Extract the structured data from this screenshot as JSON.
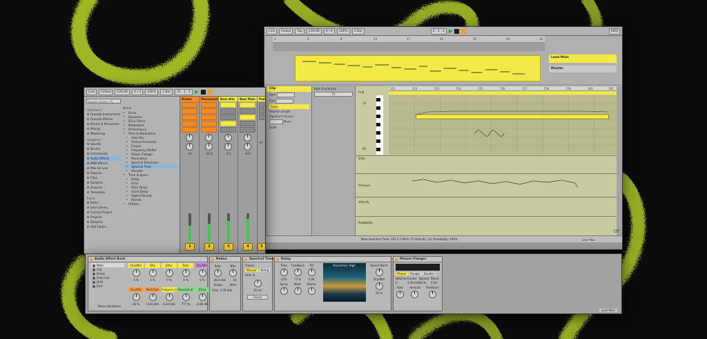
{
  "back_window": {
    "toolbar": {
      "link": "Link",
      "follow": "Follow",
      "tap": "Tap",
      "tempo": "120.00",
      "sig": "4 / 4",
      "cpu": "100%",
      "quant": "1 Bar",
      "midi": "MIDI",
      "arrangement_time": "2 . 1 . 1"
    },
    "arrangement": {
      "ruler_marks": [
        "1",
        "5",
        "9",
        "13",
        "17",
        "21",
        "25",
        "29",
        "33"
      ],
      "time_marks": [
        "0:00",
        "0:04",
        "0:08",
        "0:12",
        "0:16",
        "0:20",
        "0:24",
        "0:28",
        "0:32"
      ],
      "track_name": "Lead Main",
      "master_name": "Master",
      "track_number": "12"
    },
    "clip_panel": {
      "title": "Clip",
      "start_label": "Start",
      "end_label": "End",
      "loop_label": "Loop",
      "position_label": "Position",
      "length_label": "Length",
      "signature_label": "Signature",
      "groove_label": "Groove",
      "groove_value": "None",
      "scale_label": "Scale",
      "start_value": "1",
      "end_value": "3",
      "sig_value": "4 / 4"
    },
    "envelope_panel": {
      "title": "Note Expression",
      "value": "F3"
    },
    "midi_editor": {
      "ruler": [
        "151",
        "152",
        "153",
        "154",
        "155",
        "156",
        "157",
        "158",
        "159",
        "160",
        "161"
      ],
      "fold_label": "Fold",
      "note_labels": [
        "C4",
        "B3",
        "A3",
        "G3"
      ],
      "lanes": [
        "Slide",
        "Pressure",
        "Velocity",
        "Probability"
      ],
      "lane_values": [
        "127",
        "64",
        "0"
      ]
    },
    "status": {
      "text": "Note Selection   Time: 161.1.1   Pitch: F3   Velocity: 112   Probability: 100%"
    },
    "bottom_right": {
      "track": "Lead Main",
      "off": "Off"
    }
  },
  "front_window": {
    "toolbar": {
      "link": "Link",
      "follow": "Follow",
      "tap": "Tap",
      "tempo": "120.00",
      "sig": "4 / 4",
      "cpu": "100%",
      "quant": "1 Bar",
      "position": "21 . 1 . 1"
    },
    "browser": {
      "search_placeholder": "Search (Cmd + F)",
      "collections_header": "Collections",
      "collections": [
        "Favorite Instruments",
        "Favorite Effects",
        "Drums & Percussion",
        "Mixing",
        "Mastering"
      ],
      "categories_header": "Categories",
      "categories": [
        "Sounds",
        "Drums",
        "Instruments",
        "Audio Effects",
        "MIDI Effects",
        "Max for Live",
        "Plug-Ins",
        "Clips",
        "Samples",
        "Grooves",
        "Templates"
      ],
      "selected_category": "Audio Effects",
      "places_header": "Places",
      "places": [
        "Packs",
        "User Library",
        "Current Project",
        "Projects",
        "Samples",
        "Add Folder..."
      ],
      "folder_header": "Name",
      "folders": [
        "Drive",
        "Dynamics",
        "EQ & Filters",
        "Modulators",
        "Performance",
        "Pitch & Modulation",
        "Auto Pan",
        "Chorus-Ensemble",
        "Corpus",
        "Frequency Shifter",
        "Phaser-Flanger",
        "Resonators",
        "Spectral Resonator",
        "Spectral Time",
        "Vocoder",
        "Time & Space",
        "Delay",
        "Echo",
        "Filter Delay",
        "Grain Delay",
        "Hybrid Reverb",
        "Reverb",
        "Utilities"
      ],
      "child_folders": [
        "Auto Pan",
        "Chorus-Ensemble",
        "Corpus",
        "Frequency Shifter",
        "Phaser-Flanger",
        "Resonators",
        "Spectral Resonator",
        "Spectral Time",
        "Vocoder",
        "Delay",
        "Echo",
        "Filter Delay",
        "Grain Delay",
        "Hybrid Reverb",
        "Reverb"
      ],
      "selected_folder": "Spectral Time"
    },
    "mixer": {
      "tracks": [
        {
          "name": "Drums",
          "color": "#f7891f",
          "number": "1",
          "level": 0.55
        },
        {
          "name": "Percussion",
          "color": "#f7891f",
          "number": "2",
          "level": 0.62
        },
        {
          "name": "Bass Hits",
          "color": "#f3ea47",
          "number": "3",
          "level": 0.72
        },
        {
          "name": "Bass Main",
          "color": "#f3ea47",
          "number": "4",
          "level": 0.8
        },
        {
          "name": "Pads",
          "color": "#f3ea47",
          "number": "5",
          "level": 0.35
        }
      ],
      "send_label": "Sends",
      "values": [
        "-inf",
        "-12.0",
        "-3.5",
        "-8.0",
        "-inf"
      ]
    }
  },
  "device_chain": {
    "rack": {
      "title": "Audio Effect Rack",
      "preset": "Main",
      "chains": [
        "Arp",
        "Break",
        "Fade Out",
        "Drift",
        "End"
      ],
      "macros_row1": [
        {
          "label": "Dry/Wet",
          "color": "y"
        },
        {
          "label": "Bits",
          "color": "y"
        },
        {
          "label": "Jitter",
          "color": "y"
        },
        {
          "label": "Rate",
          "color": "y"
        },
        {
          "label": "Dry/Wet",
          "color": "p"
        },
        {
          "label": "Feedback",
          "color": "l"
        }
      ],
      "macros_row2": [
        {
          "label": "Dry/Wet",
          "color": "o"
        },
        {
          "label": "Mod Rate",
          "color": "o"
        },
        {
          "label": "Frequen-cy",
          "color": "y"
        },
        {
          "label": "Resonat-or",
          "color": "g"
        },
        {
          "label": "Drive",
          "color": "g"
        },
        {
          "label": "LFO Frequen",
          "color": "b"
        }
      ],
      "macro_values_row1": [
        "0 %",
        "0 %",
        "0 %",
        "0 %",
        "0 %",
        "0 %"
      ],
      "macro_values_row2": [
        "46 %",
        "0.20 kHz",
        "6.30 kHz",
        "777 %",
        "8.89 dB",
        "90 %"
      ],
      "footer": "Macro Variations"
    },
    "redux": {
      "title": "Redux",
      "rate_label": "Rate",
      "bits_label": "Bits",
      "rate_value": "28.0 kHz",
      "bits_value": "16",
      "shape_label": "Shape",
      "jitter_label": "Jitter",
      "filter_label": "Filter",
      "filter_value": "3.00 kHz"
    },
    "spectral_time": {
      "title": "Spectral Time",
      "freeze_label": "Freeze",
      "freeze_btn": "Freeze",
      "manual": "Manual",
      "retrig": "Retrig",
      "fade_label": "Fade In",
      "fade_value": "10 ms"
    },
    "delay": {
      "title": "Delay",
      "time_label": "Time",
      "feedback_label": "Feedback",
      "tilt_label": "Tilt",
      "spray_label": "Spray",
      "mask_label": "Mask",
      "stereo_label": "Stereo",
      "time_value": "1/16",
      "feedback_value": "77 %",
      "tilt_value": "0.00",
      "resolution": "Resolution: High",
      "sound_world": "Sound World",
      "dry_wet": "Dry/Wet",
      "dry_wet_value": "50 %"
    },
    "phaser": {
      "title": "Phaser-Flanger",
      "mode_phaser": "Phaser",
      "mode_flanger": "Flanger",
      "mode_doubler": "Doubler",
      "notches_label": "Notches",
      "center_label": "Center",
      "spread_label": "Spread",
      "blend_label": "Blend",
      "notches_value": "6",
      "center_value": "1.50 kHz",
      "spread_value": "50 %",
      "blend_value": "0.00",
      "rate_label": "Rate",
      "amount_label": "Amount",
      "feedback_label": "Feedback"
    },
    "footer_track": "Lead Main"
  }
}
